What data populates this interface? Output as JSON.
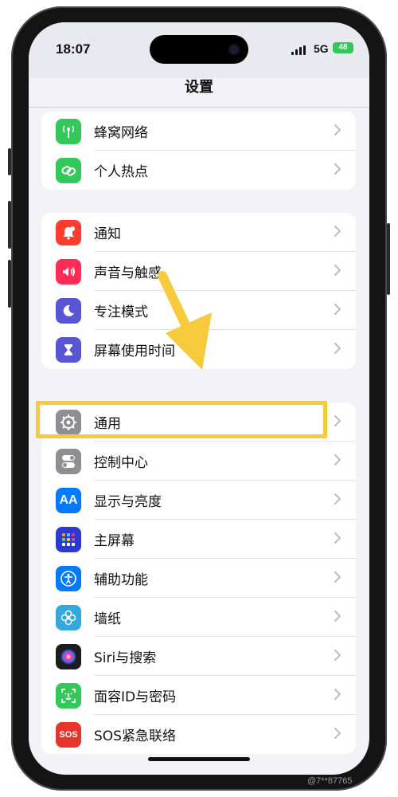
{
  "status_bar": {
    "time": "18:07",
    "network": "5G",
    "battery": "48"
  },
  "nav": {
    "title": "设置"
  },
  "groups": [
    {
      "items": [
        {
          "label": "蜂窝网络",
          "icon": "cellular-antenna-icon",
          "color": "#34c759"
        },
        {
          "label": "个人热点",
          "icon": "personal-hotspot-icon",
          "color": "#34c759"
        }
      ]
    },
    {
      "items": [
        {
          "label": "通知",
          "icon": "notifications-bell-icon",
          "color": "#ff3b30"
        },
        {
          "label": "声音与触感",
          "icon": "speaker-sound-icon",
          "color": "#ff2d55"
        },
        {
          "label": "专注模式",
          "icon": "moon-icon",
          "color": "#5856d6"
        },
        {
          "label": "屏幕使用时间",
          "icon": "hourglass-icon",
          "color": "#5856d6"
        }
      ]
    },
    {
      "items": [
        {
          "label": "通用",
          "icon": "gear-icon",
          "color": "#8e8e93"
        },
        {
          "label": "控制中心",
          "icon": "toggle-switches-icon",
          "color": "#8e8e93"
        },
        {
          "label": "显示与亮度",
          "icon": "text-size-aa-icon",
          "color": "#007aff",
          "glyph": "AA"
        },
        {
          "label": "主屏幕",
          "icon": "home-screen-grid-icon",
          "color": "#2c3ad1"
        },
        {
          "label": "辅助功能",
          "icon": "accessibility-person-icon",
          "color": "#007aff"
        },
        {
          "label": "墙纸",
          "icon": "wallpaper-flower-icon",
          "color": "#34aadc"
        },
        {
          "label": "Siri与搜索",
          "icon": "siri-orb-icon",
          "color": "#1c1c1e"
        },
        {
          "label": "面容ID与密码",
          "icon": "face-id-icon",
          "color": "#34c759"
        },
        {
          "label": "SOS紧急联络",
          "icon": "sos-icon",
          "color": "#e8352b",
          "glyph": "SOS"
        }
      ]
    }
  ],
  "annotation": {
    "highlight_color": "#f6ca3c",
    "highlighted_item": "通用"
  },
  "watermark": "@7**87765"
}
